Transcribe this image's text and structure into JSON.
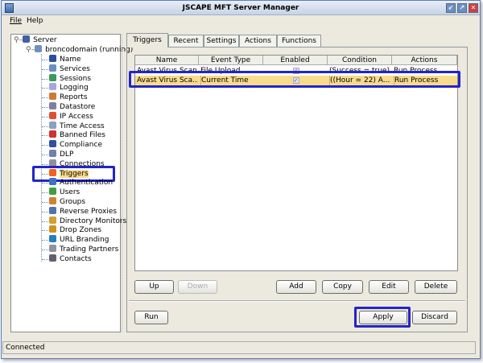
{
  "window": {
    "title": "JSCAPE MFT Server Manager"
  },
  "menu": {
    "file": "File",
    "help": "Help"
  },
  "tree": {
    "root": "Server",
    "domain": "broncodomain (running)",
    "items": [
      {
        "label": "Name",
        "icon": "person-icon",
        "color": "#2a4fa0"
      },
      {
        "label": "Services",
        "icon": "services-icon",
        "color": "#6a8fc0"
      },
      {
        "label": "Sessions",
        "icon": "sessions-icon",
        "color": "#3a9a5a"
      },
      {
        "label": "Logging",
        "icon": "logging-icon",
        "color": "#a6a6e0"
      },
      {
        "label": "Reports",
        "icon": "reports-icon",
        "color": "#d07a30"
      },
      {
        "label": "Datastore",
        "icon": "datastore-icon",
        "color": "#8080a0"
      },
      {
        "label": "IP Access",
        "icon": "ip-access-icon",
        "color": "#e05030"
      },
      {
        "label": "Time Access",
        "icon": "time-access-icon",
        "color": "#8aa0c0"
      },
      {
        "label": "Banned Files",
        "icon": "banned-files-icon",
        "color": "#d03030"
      },
      {
        "label": "Compliance",
        "icon": "compliance-icon",
        "color": "#3050a0"
      },
      {
        "label": "DLP",
        "icon": "dlp-icon",
        "color": "#7080b0"
      },
      {
        "label": "Connections",
        "icon": "connections-icon",
        "color": "#9090a0"
      },
      {
        "label": "Triggers",
        "icon": "triggers-icon",
        "color": "#f06020",
        "selected": true
      },
      {
        "label": "Authentication",
        "icon": "authentication-icon",
        "color": "#4070c0"
      },
      {
        "label": "Users",
        "icon": "users-icon",
        "color": "#40a040"
      },
      {
        "label": "Groups",
        "icon": "groups-icon",
        "color": "#d08030"
      },
      {
        "label": "Reverse Proxies",
        "icon": "reverse-proxies-icon",
        "color": "#5070b0"
      },
      {
        "label": "Directory Monitors",
        "icon": "directory-monitors-icon",
        "color": "#d0a030"
      },
      {
        "label": "Drop Zones",
        "icon": "drop-zones-icon",
        "color": "#d09020"
      },
      {
        "label": "URL Branding",
        "icon": "url-branding-icon",
        "color": "#2080c0"
      },
      {
        "label": "Trading Partners",
        "icon": "trading-partners-icon",
        "color": "#9090a0"
      },
      {
        "label": "Contacts",
        "icon": "contacts-icon",
        "color": "#606070"
      }
    ]
  },
  "tabs": [
    "Triggers",
    "Recent",
    "Settings",
    "Actions",
    "Functions"
  ],
  "table": {
    "columns": [
      "Name",
      "Event Type",
      "Enabled",
      "Condition",
      "Actions"
    ],
    "rows": [
      {
        "name": "Avast Virus Scan",
        "event": "File Upload",
        "enabled": true,
        "condition": "(Success = true)",
        "actions": "Run Process"
      },
      {
        "name": "Avast Virus Sca...",
        "event": "Current Time",
        "enabled": true,
        "condition": "((Hour = 22) A...",
        "actions": "Run Process",
        "selected": true
      }
    ]
  },
  "buttons": {
    "up": "Up",
    "down": "Down",
    "add": "Add",
    "copy": "Copy",
    "edit": "Edit",
    "delete": "Delete",
    "run": "Run",
    "apply": "Apply",
    "discard": "Discard"
  },
  "status": "Connected",
  "colors": {
    "highlight": "#2424c8",
    "selection": "#f8dc8c"
  }
}
